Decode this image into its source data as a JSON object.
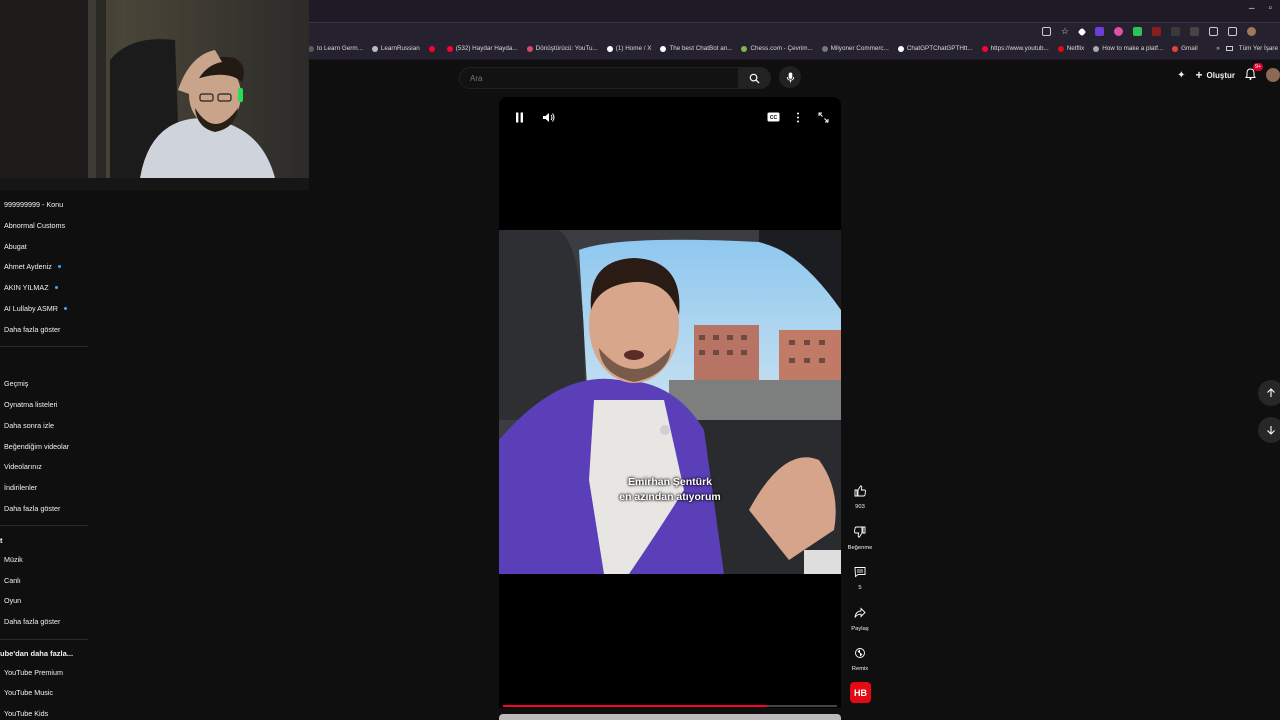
{
  "browser": {
    "bookmarks": [
      {
        "label": "to Learn Germ...",
        "color": "#5a5a5a"
      },
      {
        "label": "LearnRussian",
        "color": "#bbbbbb"
      },
      {
        "label": "",
        "color": "#ff0033"
      },
      {
        "label": "(532) Haydar Hayda...",
        "color": "#ff0033"
      },
      {
        "label": "Dönüştürücü: YouTu...",
        "color": "#d44a6a"
      },
      {
        "label": "(1) Home / X",
        "color": "#ffffff"
      },
      {
        "label": "The best ChatBot an...",
        "color": "#ffffff"
      },
      {
        "label": "Chess.com - Çevrim...",
        "color": "#81b64c"
      },
      {
        "label": "Milyoner Commerc...",
        "color": "#777777"
      },
      {
        "label": "ChatGPTChatGPTHtt...",
        "color": "#ffffff"
      },
      {
        "label": "https://www.youtub...",
        "color": "#ff0033"
      },
      {
        "label": "Netflix",
        "color": "#e50914"
      },
      {
        "label": "How to make a platf...",
        "color": "#aaaaaa"
      },
      {
        "label": "Gmail",
        "color": "#ea4335"
      }
    ],
    "overflow": "»",
    "all_bookmarks": "Tüm Yer İşare"
  },
  "masthead": {
    "search_placeholder": "Ara",
    "create_label": "Oluştur",
    "notif_badge": "9+"
  },
  "sidebar": {
    "subscriptions": [
      {
        "label": "999999999 - Konu",
        "live": false
      },
      {
        "label": "Abnormal Customs",
        "live": false
      },
      {
        "label": "Abugat",
        "live": false
      },
      {
        "label": "Ahmet Aydeniz",
        "live": true
      },
      {
        "label": "AKIN YILMAZ",
        "live": true
      },
      {
        "label": "AI Lullaby ASMR",
        "live": true
      }
    ],
    "subs_more": "Daha fazla göster",
    "you_head": "",
    "you_items": [
      "Geçmiş",
      "Oynatma listeleri",
      "Daha sonra izle",
      "Beğendiğim videolar",
      "Videolarınız",
      "İndirilenler"
    ],
    "you_more": "Daha fazla göster",
    "explore_head": "t",
    "explore_items": [
      "Müzik",
      "Canlı",
      "Oyun"
    ],
    "explore_more": "Daha fazla göster",
    "more_head": "ube'dan daha fazla...",
    "more_items": [
      "YouTube Premium",
      "YouTube Music",
      "YouTube Kids"
    ]
  },
  "player": {
    "caption_line1": "Emirhan Şentürk",
    "caption_line2": "en azından atıyorum",
    "progress": 0.79
  },
  "actions": {
    "like_count": "903",
    "dislike_label": "Beğenme",
    "comment_count": "5",
    "share_label": "Paylaş",
    "remix_label": "Remix",
    "channel_badge": "HB"
  },
  "colors": {
    "accent": "#ff0033",
    "background": "#0f0f0f"
  }
}
